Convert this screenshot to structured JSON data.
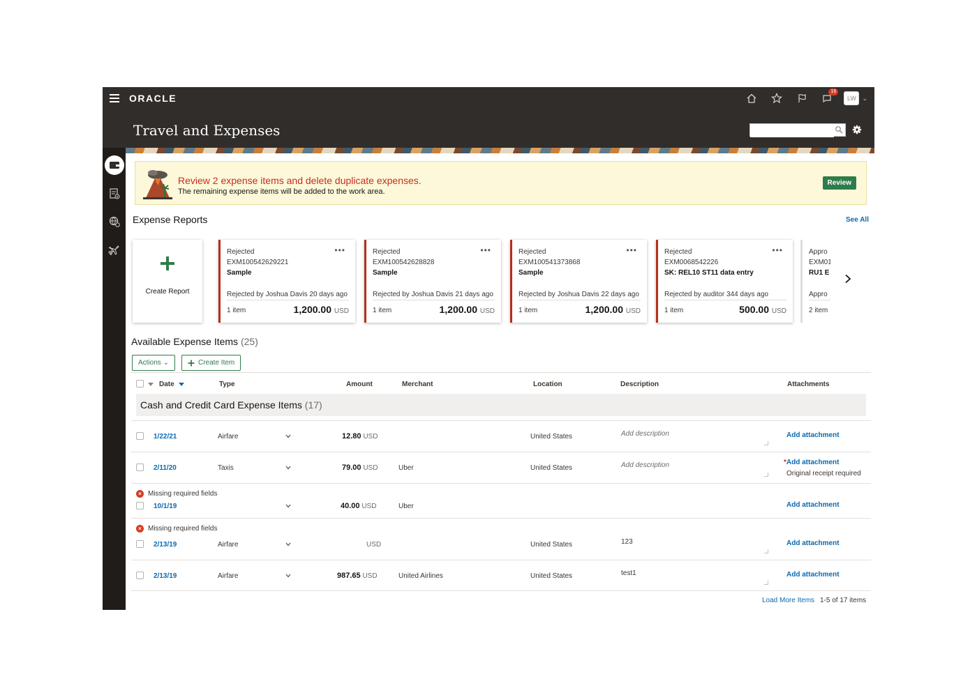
{
  "header": {
    "brand": "ORACLE",
    "app_title": "Travel and Expenses",
    "notifications_badge": "16",
    "user_initials": "LW",
    "search_placeholder": ""
  },
  "notification": {
    "title": "Review 2 expense items and delete duplicate expenses.",
    "subtitle": "The remaining expense items will be added to the work area.",
    "review_label": "Review"
  },
  "expense_reports": {
    "title": "Expense Reports",
    "see_all": "See All",
    "create_label": "Create Report",
    "cards": [
      {
        "status": "Rejected",
        "id": "EXM100542629221",
        "purpose": "Sample",
        "by": "Rejected by Joshua Davis 20 days ago",
        "items": "1 item",
        "amount": "1,200.00",
        "currency": "USD"
      },
      {
        "status": "Rejected",
        "id": "EXM100542628828",
        "purpose": "Sample",
        "by": "Rejected by Joshua Davis 21 days ago",
        "items": "1 item",
        "amount": "1,200.00",
        "currency": "USD"
      },
      {
        "status": "Rejected",
        "id": "EXM100541373868",
        "purpose": "Sample",
        "by": "Rejected by Joshua Davis 22 days ago",
        "items": "1 item",
        "amount": "1,200.00",
        "currency": "USD"
      },
      {
        "status": "Rejected",
        "id": "EXM0068542226",
        "purpose": "SK: REL10 ST11 data entry",
        "by": "Rejected by auditor 344 days ago",
        "items": "1 item",
        "amount": "500.00",
        "currency": "USD"
      },
      {
        "status": "Appro",
        "id": "EXM01",
        "purpose": "RU1 E",
        "by": "Appro",
        "items": "2 item"
      }
    ]
  },
  "items": {
    "title": "Available Expense Items",
    "count": "(25)",
    "actions_label": "Actions",
    "create_item_label": "Create Item",
    "columns": {
      "date": "Date",
      "type": "Type",
      "amount": "Amount",
      "merchant": "Merchant",
      "location": "Location",
      "description": "Description",
      "attachments": "Attachments"
    },
    "group": {
      "label": "Cash and Credit Card Expense Items",
      "count": "(17)"
    },
    "rows": [
      {
        "date": "1/22/21",
        "type": "Airfare",
        "amount": "12.80",
        "currency": "USD",
        "merchant": "",
        "location": "United States",
        "description": "Add description",
        "attachment": "Add attachment"
      },
      {
        "date": "2/11/20",
        "type": "Taxis",
        "amount": "79.00",
        "currency": "USD",
        "merchant": "Uber",
        "location": "United States",
        "description": "Add description",
        "attachment": "Add attachment",
        "attachment_note": "Original receipt required",
        "required_mark": "*"
      },
      {
        "error": "Missing required fields",
        "date": "10/1/19",
        "type": "",
        "amount": "40.00",
        "currency": "USD",
        "merchant": "Uber",
        "location": "",
        "description": "",
        "attachment": "Add attachment"
      },
      {
        "error": "Missing required fields",
        "date": "2/13/19",
        "type": "Airfare",
        "amount": "",
        "currency": "USD",
        "merchant": "",
        "location": "United States",
        "description": "123",
        "attachment": "Add attachment"
      },
      {
        "date": "2/13/19",
        "type": "Airfare",
        "amount": "987.65",
        "currency": "USD",
        "merchant": "United Airlines",
        "location": "United States",
        "description": "test1",
        "attachment": "Add attachment"
      }
    ],
    "load_more": "Load More Items",
    "range": "1-5 of 17 items"
  }
}
